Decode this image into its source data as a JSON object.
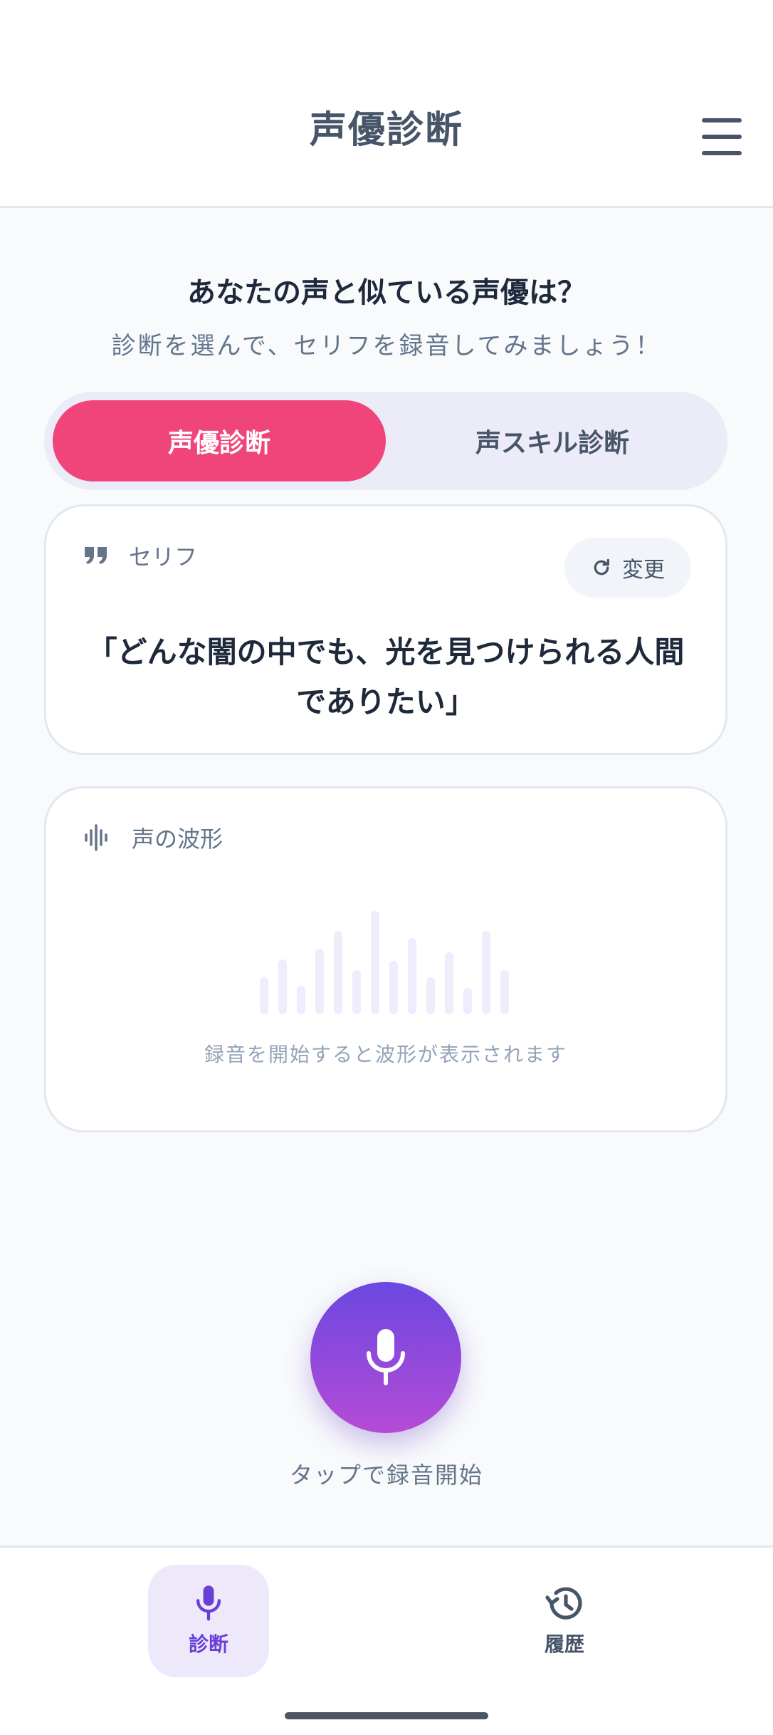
{
  "header": {
    "title": "声優診断"
  },
  "intro": {
    "title": "あなたの声と似ている声優は？",
    "subtitle": "診断を選んで、セリフを録音してみましょう！"
  },
  "tabs": [
    {
      "label": "声優診断",
      "active": true
    },
    {
      "label": "声スキル診断",
      "active": false
    }
  ],
  "quote_card": {
    "label": "セリフ",
    "change_label": "変更",
    "quote": "「どんな闇の中でも、光を見つけられる人間でありたい」"
  },
  "wave_card": {
    "label": "声の波形",
    "hint": "録音を開始すると波形が表示されます"
  },
  "record": {
    "label": "タップで録音開始"
  },
  "bottom_nav": [
    {
      "label": "診断",
      "icon": "mic-icon",
      "active": true
    },
    {
      "label": "履歴",
      "icon": "history-icon",
      "active": false
    }
  ],
  "colors": {
    "accent_pink": "#f0457a",
    "accent_purple": "#6a3fd8",
    "wave_placeholder": "#efecfb"
  }
}
